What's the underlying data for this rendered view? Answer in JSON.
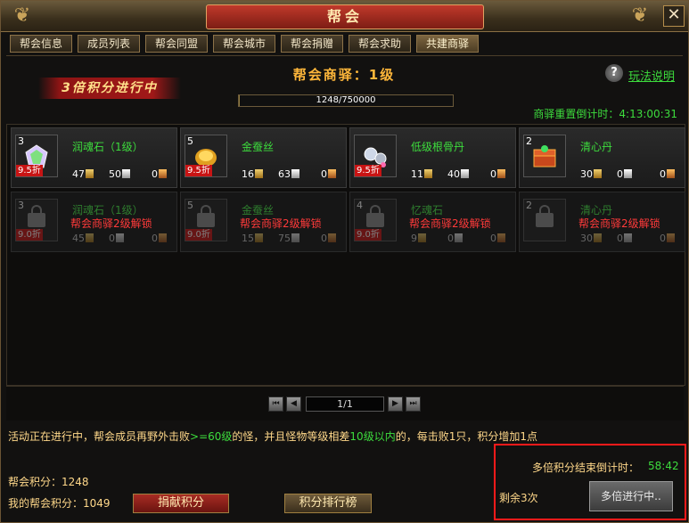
{
  "window": {
    "title": "帮会",
    "close": "✕"
  },
  "tabs": [
    {
      "label": "帮会信息",
      "active": false
    },
    {
      "label": "成员列表",
      "active": false
    },
    {
      "label": "帮会同盟",
      "active": false
    },
    {
      "label": "帮会城市",
      "active": false
    },
    {
      "label": "帮会捐赠",
      "active": false
    },
    {
      "label": "帮会求助",
      "active": false
    },
    {
      "label": "共建商驿",
      "active": true
    }
  ],
  "banner": "3倍积分进行中",
  "post": {
    "title": "帮会商驿：1级",
    "progress_text": "1248/750000",
    "progress_fraction": 0.00166,
    "reset_timer": "商驿重置倒计时：4:13:00:31"
  },
  "help": {
    "icon": "?",
    "label": "玩法说明"
  },
  "items": [
    {
      "qty": "3",
      "discount": "9.5折",
      "name": "润魂石（1级）",
      "stats": [
        "47",
        "50",
        "0"
      ],
      "icon": "gem-box-icon"
    },
    {
      "qty": "5",
      "discount": "9.5折",
      "name": "金蚕丝",
      "stats": [
        "16",
        "63",
        "0"
      ],
      "icon": "silk-icon"
    },
    {
      "qty": "",
      "discount": "9.5折",
      "name": "低级根骨丹",
      "stats": [
        "11",
        "40",
        "0"
      ],
      "icon": "pills-icon"
    },
    {
      "qty": "2",
      "discount": "",
      "name": "清心丹",
      "stats": [
        "30",
        "0",
        "0"
      ],
      "icon": "chest-icon"
    },
    {
      "qty": "3",
      "discount": "9.0折",
      "name": "润魂石（1级）",
      "unlock": "帮会商驿2级解锁",
      "stats": [
        "45",
        "0",
        "0"
      ],
      "icon": "lock-icon"
    },
    {
      "qty": "5",
      "discount": "9.0折",
      "name": "金蚕丝",
      "unlock": "帮会商驿2级解锁",
      "stats": [
        "15",
        "75",
        "0"
      ],
      "icon": "lock-icon"
    },
    {
      "qty": "4",
      "discount": "9.0折",
      "name": "忆魂石",
      "unlock": "帮会商驿2级解锁",
      "stats": [
        "9",
        "0",
        "0"
      ],
      "icon": "lock-icon"
    },
    {
      "qty": "2",
      "discount": "",
      "name": "清心丹",
      "unlock": "帮会商驿2级解锁",
      "stats": [
        "30",
        "0",
        "0"
      ],
      "icon": "lock-icon"
    }
  ],
  "pager": {
    "text": "1/1"
  },
  "description": {
    "p1": "活动正在进行中，帮会成员再野外击败",
    "hl1": ">=60级",
    "p2": "的怪，并且怪物等级相差",
    "hl2": "10级以内",
    "p3": "的，每击败1只，积分增加1点"
  },
  "points": {
    "guild": "帮会积分：1248",
    "mine": "我的帮会积分：1049"
  },
  "buttons": {
    "donate": "捐献积分",
    "ranking": "积分排行榜"
  },
  "multiplier": {
    "label": "多倍积分结束倒计时：",
    "time": "58:42",
    "remaining": "剩余3次",
    "status": "多倍进行中.."
  },
  "colors": {
    "accent_green": "#3ddc3d",
    "warning_red": "#ff3a3a",
    "title_orange": "#ffb73a",
    "highlight_box": "#ff1a1a"
  }
}
